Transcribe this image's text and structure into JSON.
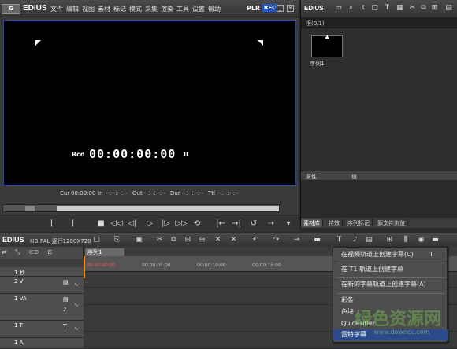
{
  "app": {
    "brand": "EDIUS",
    "menu": [
      "文件",
      "编辑",
      "视图",
      "素材",
      "标记",
      "模式",
      "采集",
      "渲染",
      "工具",
      "设置",
      "帮助"
    ],
    "plr": "PLR",
    "rec": "REC"
  },
  "player": {
    "timecode_label": "Rcd",
    "timecode": "00:00:00:00",
    "timecode_suffix": "II",
    "info": {
      "cur_label": "Cur",
      "cur_value": "00:00:00",
      "in_label": "In",
      "in_value": "--:--:--:--",
      "out_label": "Out",
      "out_value": "--:--:--:--",
      "dur_label": "Dur",
      "dur_value": "--:--:--:--",
      "ttl_label": "Ttl",
      "ttl_value": "--:--:--:--"
    }
  },
  "bin": {
    "title": "EDIUS",
    "folder": "根(0/1)",
    "clip_name": "序列1",
    "prop_col1": "属性",
    "prop_col2": "值",
    "tabs": [
      "素材库",
      "特效",
      "序列标记",
      "源文件浏览"
    ]
  },
  "timeline": {
    "brand": "EDIUS",
    "project": "HD PAL 逐行1280X720",
    "sequence_tab": "序列1",
    "ruler": [
      "00:00:00:00",
      "00:00:05:00",
      "00:00:10:00",
      "00:00:15:00"
    ],
    "tracks": [
      {
        "name": "1 秒",
        "tall": false
      },
      {
        "name": "2 V",
        "tall": true
      },
      {
        "name": "1 VA",
        "tall": true
      },
      {
        "name": "1 T",
        "tall": false
      },
      {
        "name": "1 A",
        "tall": false
      }
    ]
  },
  "context_menu": {
    "items": [
      {
        "label": "在视频轨道上创建字幕(C)",
        "shortcut": "T",
        "highlight": false
      },
      {
        "label": "在 T1 轨道上创建字幕",
        "shortcut": "",
        "highlight": false
      },
      {
        "label": "在新的字幕轨道上创建字幕(A)",
        "shortcut": "",
        "highlight": false
      },
      {
        "label": "彩条",
        "shortcut": "",
        "highlight": false
      },
      {
        "label": "色块",
        "shortcut": "",
        "highlight": false
      },
      {
        "label": "QuickTitler",
        "shortcut": "",
        "highlight": false
      },
      {
        "label": "雷特字幕",
        "shortcut": "",
        "highlight": true
      }
    ]
  },
  "watermark": {
    "text": "绿色资源网",
    "url": "www.downcc.com"
  }
}
